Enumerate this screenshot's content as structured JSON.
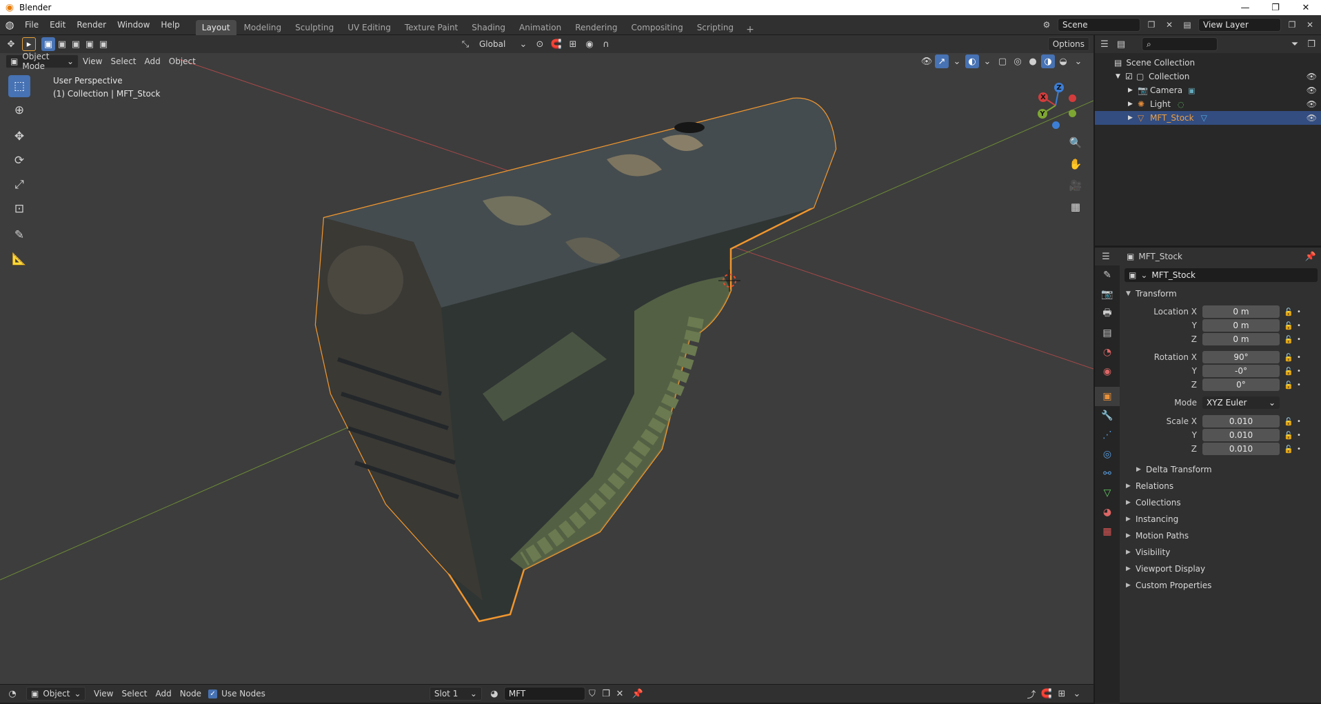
{
  "window": {
    "title": "Blender",
    "minimize": "—",
    "maximize": "❐",
    "close": "✕"
  },
  "menu": [
    "File",
    "Edit",
    "Render",
    "Window",
    "Help"
  ],
  "workspaces": [
    "Layout",
    "Modeling",
    "Sculpting",
    "UV Editing",
    "Texture Paint",
    "Shading",
    "Animation",
    "Rendering",
    "Compositing",
    "Scripting"
  ],
  "active_workspace": "Layout",
  "scene": {
    "label": "Scene",
    "view_layer": "View Layer"
  },
  "viewport_header": {
    "mode": "Object Mode",
    "menus": [
      "View",
      "Select",
      "Add",
      "Object"
    ],
    "orientation": "Global",
    "options": "Options"
  },
  "viewport_overlay": {
    "perspective": "User Perspective",
    "context": "(1) Collection | MFT_Stock"
  },
  "gizmo": {
    "x": "X",
    "y": "Y",
    "z": "Z"
  },
  "bottom_bar": {
    "editor_mode": "Object",
    "menus": [
      "View",
      "Select",
      "Add",
      "Node"
    ],
    "use_nodes": "Use Nodes",
    "slot": "Slot 1",
    "material": "MFT"
  },
  "outliner": {
    "scene_collection": "Scene Collection",
    "collection": "Collection",
    "items": [
      {
        "name": "Camera",
        "icon": "camera-icon"
      },
      {
        "name": "Light",
        "icon": "light-icon"
      },
      {
        "name": "MFT_Stock",
        "icon": "mesh-icon"
      }
    ]
  },
  "properties": {
    "header_object": "MFT_Stock",
    "object_name": "MFT_Stock",
    "transform_title": "Transform",
    "location": {
      "label": "Location X",
      "x": "0 m",
      "y": "0 m",
      "z": "0 m"
    },
    "rotation": {
      "label": "Rotation X",
      "x": "90°",
      "y": "-0°",
      "z": "0°"
    },
    "mode_label": "Mode",
    "mode_value": "XYZ Euler",
    "scale": {
      "label": "Scale X",
      "x": "0.010",
      "y": "0.010",
      "z": "0.010"
    },
    "axis_y": "Y",
    "axis_z": "Z",
    "delta_transform": "Delta Transform",
    "panels": [
      "Relations",
      "Collections",
      "Instancing",
      "Motion Paths",
      "Visibility",
      "Viewport Display",
      "Custom Properties"
    ]
  },
  "colors": {
    "accent": "#4772b3",
    "selection_outline": "#f0962e",
    "x_axis": "#d33c3c",
    "y_axis": "#7ea632",
    "z_axis": "#3c7ed6"
  }
}
